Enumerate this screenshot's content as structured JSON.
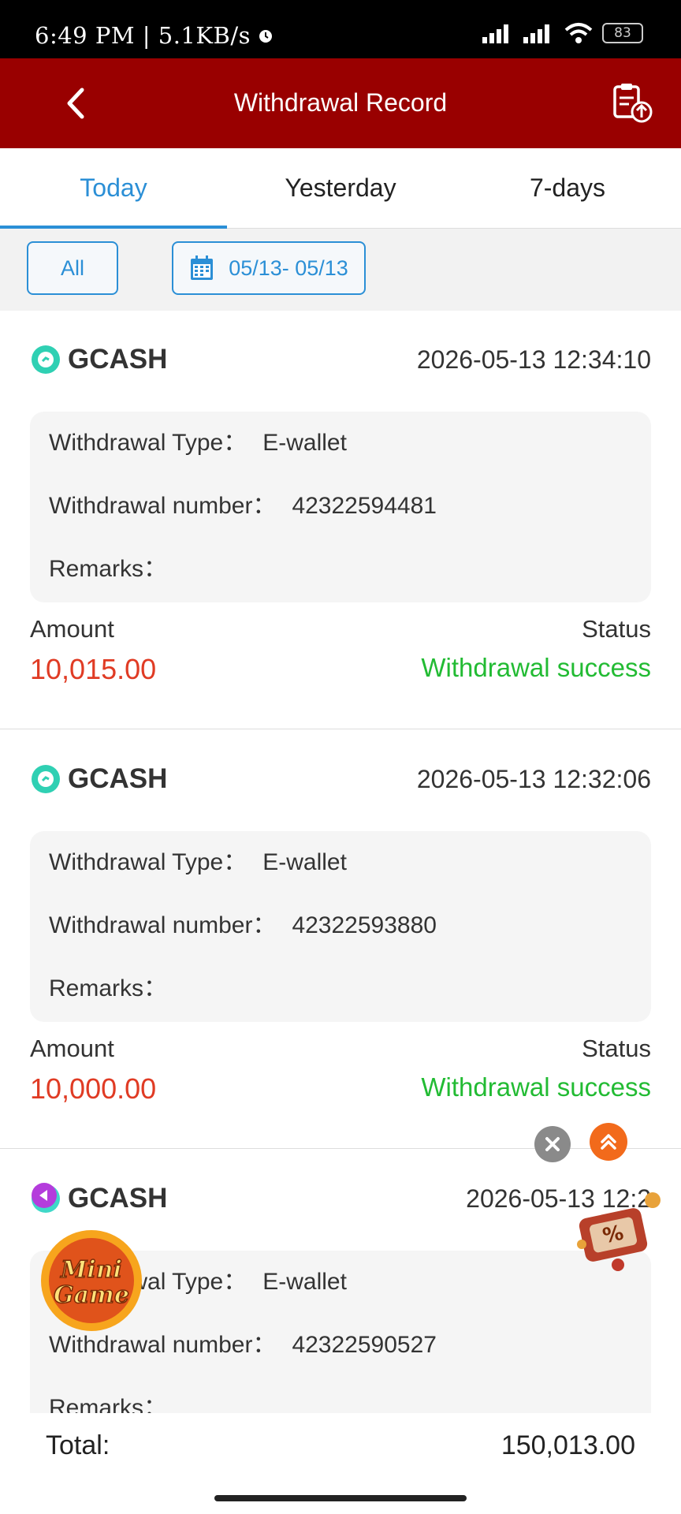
{
  "status_bar": {
    "time_speed": "6:49 PM | 5.1KB/s",
    "battery": "83"
  },
  "header": {
    "title": "Withdrawal Record"
  },
  "tabs": [
    {
      "label": "Today",
      "active": true
    },
    {
      "label": "Yesterday",
      "active": false
    },
    {
      "label": "7-days",
      "active": false
    }
  ],
  "filters": {
    "type": "All",
    "date_range": "05/13- 05/13"
  },
  "labels": {
    "withdrawal_type": "Withdrawal Type：",
    "withdrawal_number": "Withdrawal number：",
    "remarks": "Remarks：",
    "amount": "Amount",
    "status": "Status"
  },
  "records": [
    {
      "brand": "GCASH",
      "time": "2026-05-13 12:34:10",
      "type": "E-wallet",
      "number": "42322594481",
      "remarks": "",
      "amount": "10,015.00",
      "status": "Withdrawal success"
    },
    {
      "brand": "GCASH",
      "time": "2026-05-13 12:32:06",
      "type": "E-wallet",
      "number": "42322593880",
      "remarks": "",
      "amount": "10,000.00",
      "status": "Withdrawal success"
    },
    {
      "brand": "GCASH",
      "time": "2026-05-13 12:2",
      "type": "E-wallet",
      "number": "42322590527",
      "remarks": "",
      "amount": "",
      "status": ""
    }
  ],
  "footer": {
    "total_label": "Total:",
    "total_value": "150,013.00"
  },
  "floating": {
    "minigame_text": "Mini Game",
    "promo_text": "%"
  },
  "colors": {
    "header_bg": "#990000",
    "accent": "#2b8fd6",
    "amount": "#e03b24",
    "success": "#22bb33"
  }
}
